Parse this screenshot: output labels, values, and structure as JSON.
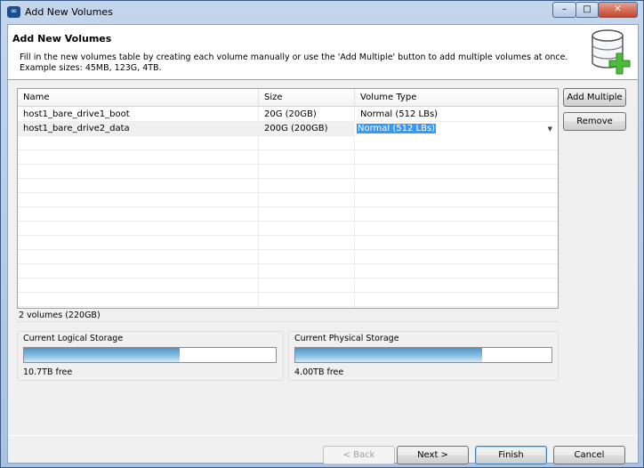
{
  "window": {
    "title": "Add New Volumes",
    "controls": [
      "minimize",
      "maximize",
      "close"
    ]
  },
  "header": {
    "title": "Add New Volumes",
    "description_line1": "Fill in the new volumes table by creating each volume manually or use the 'Add Multiple' button to add multiple volumes at once.",
    "description_line2": "Example sizes: 45MB, 123G, 4TB.",
    "icon": "database-add-icon"
  },
  "table": {
    "columns": [
      "Name",
      "Size",
      "Volume Type"
    ],
    "rows": [
      {
        "name": "host1_bare_drive1_boot",
        "size": "20G (20GB)",
        "type": "Normal (512 LBs)"
      },
      {
        "name": "host1_bare_drive2_data",
        "size": "200G (200GB)",
        "type": "Normal (512 LBs)",
        "editing": true
      }
    ]
  },
  "side_buttons": {
    "add_multiple": "Add Multiple",
    "remove": "Remove"
  },
  "status": "2 volumes (220GB)",
  "storage": {
    "logical": {
      "label": "Current Logical Storage",
      "free": "10.7TB free",
      "used_fraction": 0.62
    },
    "physical": {
      "label": "Current Physical Storage",
      "free": "4.00TB free",
      "used_fraction": 0.73
    }
  },
  "footer": {
    "back": "< Back",
    "next": "Next >",
    "finish": "Finish",
    "cancel": "Cancel"
  },
  "colors": {
    "selection": "#3399ff",
    "bar_fill": "#4f95c9"
  }
}
